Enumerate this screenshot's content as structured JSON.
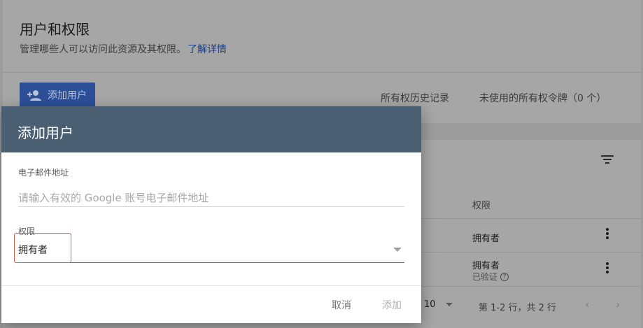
{
  "header": {
    "title": "用户和权限",
    "subtitle": "管理哪些人可以访问此资源及其权限。",
    "learn_more": "了解详情"
  },
  "toolbar": {
    "add_user_label": "添加用户",
    "history_label": "所有权历史记录",
    "unused_tokens_label": "未使用的所有权令牌（0 个）"
  },
  "table": {
    "permission_header": "权限",
    "rows": [
      {
        "permission": "拥有者",
        "status": ""
      },
      {
        "permission": "拥有者",
        "status": "已验证"
      }
    ],
    "pagination": {
      "page_size": "10",
      "range_text": "第 1-2 行，共 2 行"
    }
  },
  "dialog": {
    "title": "添加用户",
    "email_label": "电子邮件地址",
    "email_placeholder": "请输入有效的 Google 账号电子邮件地址",
    "permission_label": "权限",
    "permission_value": "拥有者",
    "cancel_label": "取消",
    "add_label": "添加"
  },
  "colors": {
    "dialog_header": "#4a5f71",
    "primary_button": "#2c4f97",
    "highlight": "#e25c47"
  },
  "icons": [
    "add-person-icon",
    "filter-icon",
    "more-vert-icon",
    "help-icon",
    "chevron-left-icon",
    "chevron-right-icon",
    "dropdown-caret-icon"
  ]
}
